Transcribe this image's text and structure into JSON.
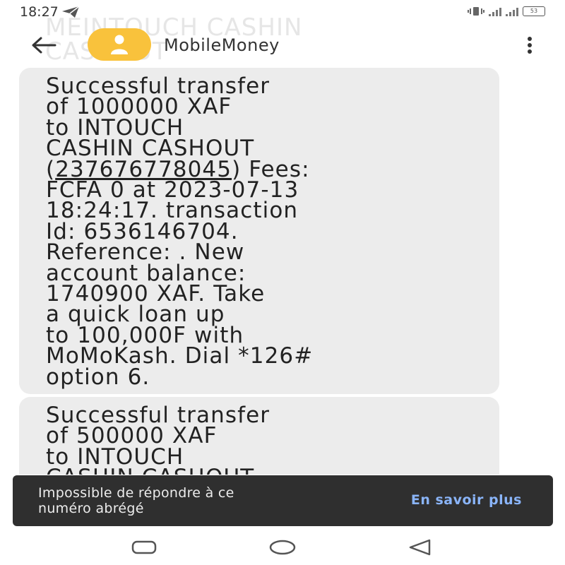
{
  "status_bar": {
    "time": "18:27",
    "battery": "53",
    "icons": [
      "telegram-icon",
      "vibrate-icon",
      "signal-icon",
      "battery-icon"
    ]
  },
  "ghost_header_text": [
    "MEINTOUCH CASHIN",
    "CASHOUT"
  ],
  "header": {
    "contact_name": "MobileMoney",
    "back_icon": "arrow-left",
    "avatar_icon": "person",
    "avatar_color": "#F9C23C",
    "menu_icon": "vertical-dots"
  },
  "messages": [
    {
      "lines": [
        "Successful transfer",
        "of 1000000 XAF",
        "to INTOUCH",
        "CASHIN CASHOUT",
        "(237676778045) Fees:",
        "FCFA 0 at 2023-07-13",
        "18:24:17. transaction",
        "Id: 6536146704.",
        "Reference: . New",
        "account balance:",
        "1740900 XAF. Take",
        "a quick loan up",
        "to 100,000F with",
        "MoMoKash. Dial *126#",
        "option 6."
      ],
      "phone_link": "237676778045"
    },
    {
      "lines": [
        "Successful transfer",
        "of 500000 XAF",
        "to INTOUCH",
        "CASHIN CASHOUT"
      ]
    }
  ],
  "snackbar": {
    "message": "Impossible de répondre à ce\nnuméro abrégé",
    "action": "En savoir plus"
  },
  "nav_bar": {
    "buttons": [
      "recents-button",
      "home-button",
      "back-button"
    ]
  },
  "colors": {
    "bubble": "#ececec",
    "snackbar_bg": "#2f2f2f",
    "snackbar_action": "#8ab4f8"
  }
}
